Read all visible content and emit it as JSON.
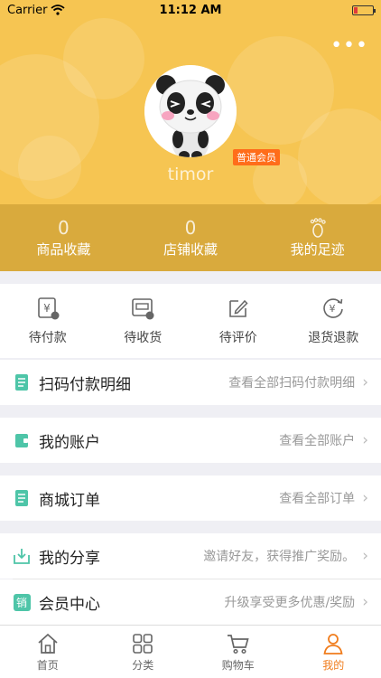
{
  "status_bar": {
    "carrier": "Carrier",
    "time": "11:12 AM"
  },
  "profile": {
    "username": "timor",
    "member_level": "普通会员"
  },
  "stats": [
    {
      "count": "0",
      "label": "商品收藏"
    },
    {
      "count": "0",
      "label": "店铺收藏"
    },
    {
      "count": "",
      "label": "我的足迹"
    }
  ],
  "orders": [
    {
      "label": "待付款",
      "icon": "yen-card-icon"
    },
    {
      "label": "待收货",
      "icon": "package-icon"
    },
    {
      "label": "待评价",
      "icon": "edit-icon"
    },
    {
      "label": "退货退款",
      "icon": "refund-icon"
    }
  ],
  "menu": [
    {
      "title": "扫码付款明细",
      "desc": "查看全部扫码付款明细",
      "icon": "document-icon"
    },
    {
      "title": "我的账户",
      "desc": "查看全部账户",
      "icon": "wallet-icon"
    },
    {
      "title": "商城订单",
      "desc": "查看全部订单",
      "icon": "document-icon"
    },
    {
      "title": "我的分享",
      "desc": "邀请好友，获得推广奖励。",
      "icon": "share-inbox-icon"
    },
    {
      "title": "会员中心",
      "desc": "升级享受更多优惠/奖励",
      "icon": "member-badge-icon",
      "icon_text": "销"
    }
  ],
  "tabs": [
    {
      "label": "首页",
      "icon": "home-icon"
    },
    {
      "label": "分类",
      "icon": "grid-icon"
    },
    {
      "label": "购物车",
      "icon": "cart-icon"
    },
    {
      "label": "我的",
      "icon": "person-icon",
      "active": true
    }
  ],
  "colors": {
    "header": "#f6c552",
    "stats_bar": "#d9aa3d",
    "accent": "#f07c1c",
    "menu_icon": "#4ec5a8"
  }
}
